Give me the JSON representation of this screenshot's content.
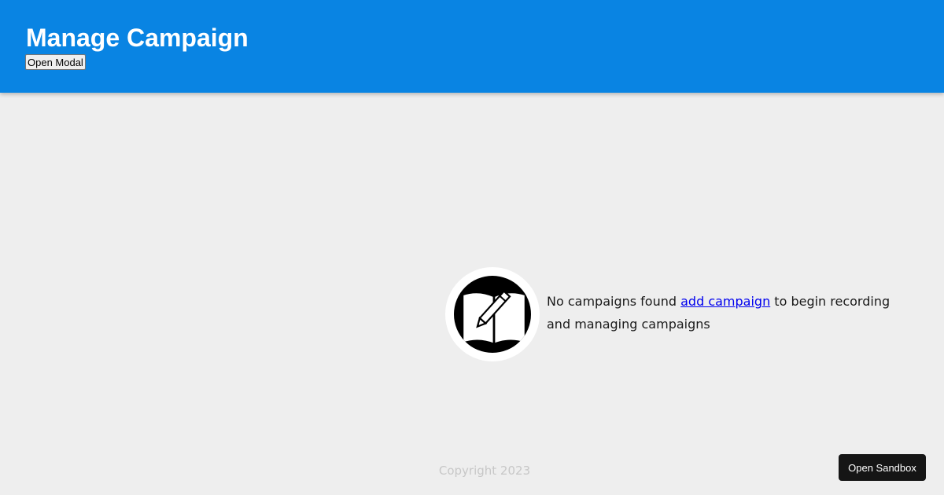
{
  "header": {
    "title": "Manage Campaign",
    "open_modal_label": "Open Modal",
    "background": "#0984e3"
  },
  "empty_state": {
    "icon": "book-pencil-icon",
    "text_before": "No campaigns found ",
    "link_label": "add campaign",
    "text_after": " to begin recording and managing campaigns"
  },
  "footer": {
    "copyright": "Copyright  2023"
  },
  "sandbox_button": {
    "label": "Open Sandbox"
  }
}
